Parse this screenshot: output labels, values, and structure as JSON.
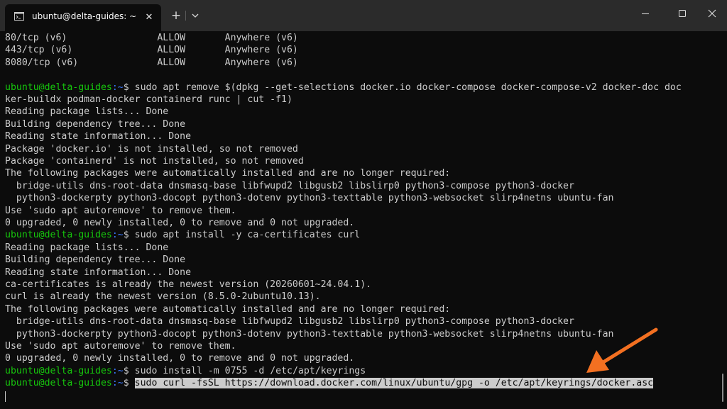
{
  "colors": {
    "background": "#0c0c0c",
    "titlebar": "#2b2b2b",
    "text": "#cccccc",
    "prompt_user": "#16c60c",
    "prompt_path": "#3b78ff",
    "annotation_arrow": "#f37021"
  },
  "titlebar": {
    "tab_title": "ubuntu@delta-guides: ~",
    "tab_icon": "terminal-icon",
    "close_tab": "✕",
    "new_tab": "+",
    "dropdown_icon": "chevron-down-icon",
    "window_controls": [
      "minimize-icon",
      "maximize-icon",
      "close-icon"
    ]
  },
  "terminal": {
    "prompt_user": "ubuntu@delta-guides",
    "prompt_path": ":~",
    "prompt_symbol": "$",
    "lines": [
      {
        "type": "output",
        "text": "80/tcp (v6)                ALLOW       Anywhere (v6)"
      },
      {
        "type": "output",
        "text": "443/tcp (v6)               ALLOW       Anywhere (v6)"
      },
      {
        "type": "output",
        "text": "8080/tcp (v6)              ALLOW       Anywhere (v6)"
      },
      {
        "type": "blank",
        "text": ""
      },
      {
        "type": "command",
        "text": " sudo apt remove $(dpkg --get-selections docker.io docker-compose docker-compose-v2 docker-doc doc"
      },
      {
        "type": "output",
        "text": "ker-buildx podman-docker containerd runc | cut -f1)"
      },
      {
        "type": "output",
        "text": "Reading package lists... Done"
      },
      {
        "type": "output",
        "text": "Building dependency tree... Done"
      },
      {
        "type": "output",
        "text": "Reading state information... Done"
      },
      {
        "type": "output",
        "text": "Package 'docker.io' is not installed, so not removed"
      },
      {
        "type": "output",
        "text": "Package 'containerd' is not installed, so not removed"
      },
      {
        "type": "output",
        "text": "The following packages were automatically installed and are no longer required:"
      },
      {
        "type": "output",
        "text": "  bridge-utils dns-root-data dnsmasq-base libfwupd2 libgusb2 libslirp0 python3-compose python3-docker"
      },
      {
        "type": "output",
        "text": "  python3-dockerpty python3-docopt python3-dotenv python3-texttable python3-websocket slirp4netns ubuntu-fan"
      },
      {
        "type": "output",
        "text": "Use 'sudo apt autoremove' to remove them."
      },
      {
        "type": "output",
        "text": "0 upgraded, 0 newly installed, 0 to remove and 0 not upgraded."
      },
      {
        "type": "command",
        "text": " sudo apt install -y ca-certificates curl"
      },
      {
        "type": "output",
        "text": "Reading package lists... Done"
      },
      {
        "type": "output",
        "text": "Building dependency tree... Done"
      },
      {
        "type": "output",
        "text": "Reading state information... Done"
      },
      {
        "type": "output",
        "text": "ca-certificates is already the newest version (20260601~24.04.1)."
      },
      {
        "type": "output",
        "text": "curl is already the newest version (8.5.0-2ubuntu10.13)."
      },
      {
        "type": "output",
        "text": "The following packages were automatically installed and are no longer required:"
      },
      {
        "type": "output",
        "text": "  bridge-utils dns-root-data dnsmasq-base libfwupd2 libgusb2 libslirp0 python3-compose python3-docker"
      },
      {
        "type": "output",
        "text": "  python3-dockerpty python3-docopt python3-dotenv python3-texttable python3-websocket slirp4netns ubuntu-fan"
      },
      {
        "type": "output",
        "text": "Use 'sudo apt autoremove' to remove them."
      },
      {
        "type": "output",
        "text": "0 upgraded, 0 newly installed, 0 to remove and 0 not upgraded."
      },
      {
        "type": "command",
        "text": " sudo install -m 0755 -d /etc/apt/keyrings"
      },
      {
        "type": "command_selected",
        "text": "sudo curl -fsSL https://download.docker.com/linux/ubuntu/gpg -o /etc/apt/keyrings/docker.asc"
      }
    ]
  }
}
